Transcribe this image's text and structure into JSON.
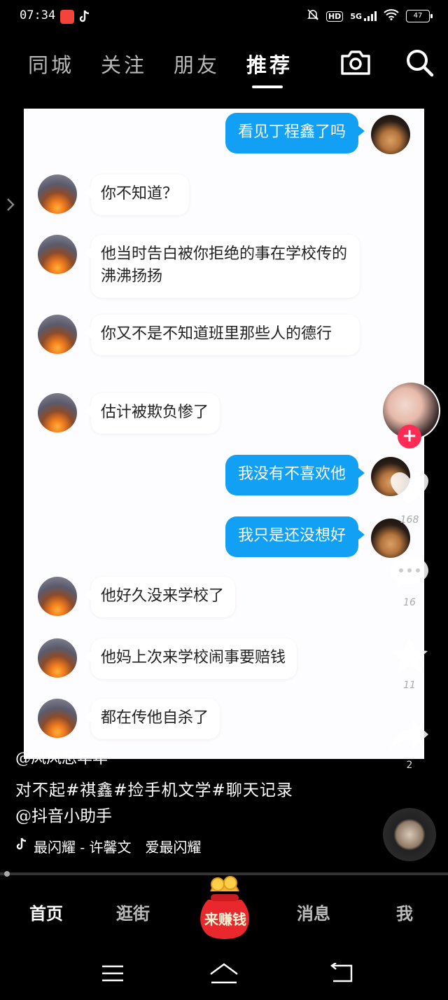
{
  "status_bar": {
    "time": "07:34",
    "network": "5G",
    "hd": "HD",
    "battery": "47"
  },
  "top_tabs": [
    {
      "label": "同城",
      "active": false
    },
    {
      "label": "关注",
      "active": false
    },
    {
      "label": "朋友",
      "active": false
    },
    {
      "label": "推荐",
      "active": true
    }
  ],
  "chat": {
    "messages": [
      {
        "side": "out",
        "text": "看见丁程鑫了吗"
      },
      {
        "side": "in",
        "text": "你不知道？"
      },
      {
        "side": "in",
        "text": "他当时告白被你拒绝的事在学校传的沸沸扬扬"
      },
      {
        "side": "in",
        "text": "你又不是不知道班里那些人的德行"
      },
      {
        "side": "in",
        "text": "估计被欺负惨了"
      },
      {
        "side": "out",
        "text": "我没有不喜欢他"
      },
      {
        "side": "out",
        "text": "我只是还没想好"
      },
      {
        "side": "in",
        "text": "他好久没来学校了"
      },
      {
        "side": "in",
        "text": "他妈上次来学校闹事要赔钱"
      },
      {
        "side": "in",
        "text": "都在传他自杀了"
      }
    ]
  },
  "rail": {
    "likes": "168",
    "comments": "16",
    "favorites": "11",
    "shares": "2"
  },
  "post": {
    "author": "@风风念年年",
    "caption": "对不起#祺鑫#捡手机文学#聊天记录",
    "mention": "@抖音小助手",
    "music": "最闪耀 - 许馨文　爱最闪耀"
  },
  "bottom_nav": {
    "home": "首页",
    "shop": "逛街",
    "earn": "来赚钱",
    "messages": "消息",
    "me": "我"
  },
  "colors": {
    "bubble_out": "#12a0f5",
    "follow": "#fe2c55"
  }
}
